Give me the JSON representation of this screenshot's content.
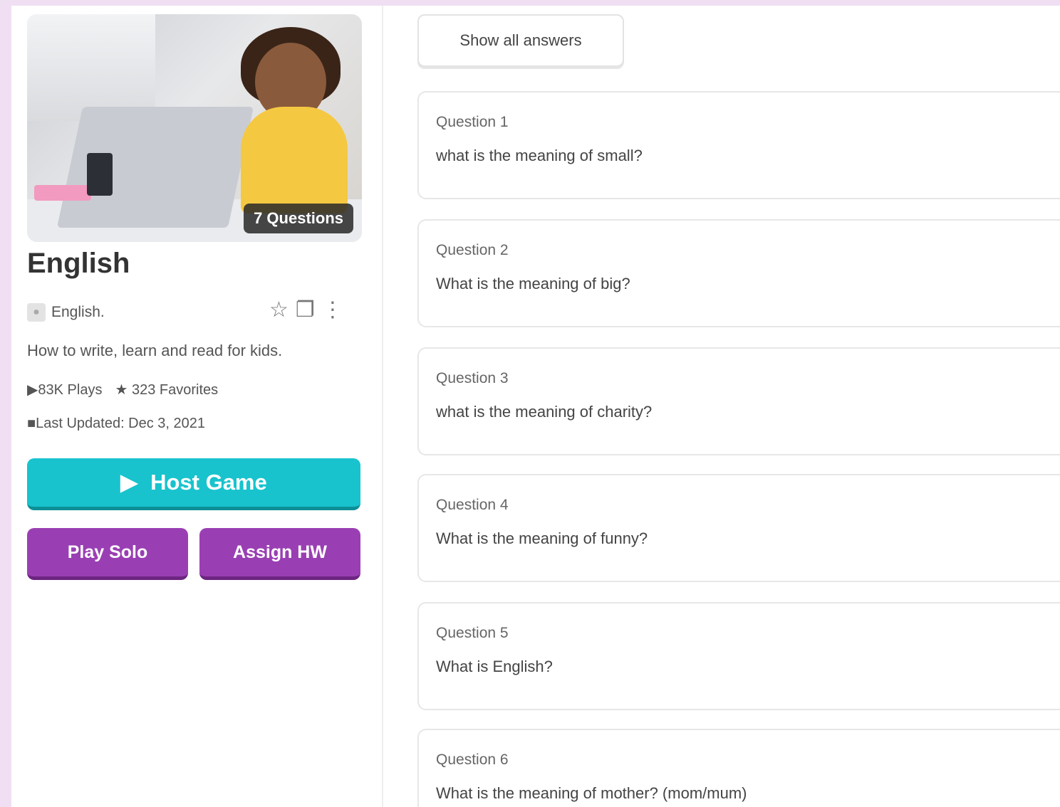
{
  "quiz": {
    "question_count_badge": "7 Questions",
    "title": "English",
    "author": "English.",
    "description": "How to write, learn and read for kids.",
    "plays": "83K Plays",
    "favorites": "323 Favorites",
    "last_updated": "Last Updated: Dec 3, 2021"
  },
  "buttons": {
    "host_game": "Host Game",
    "play_solo": "Play Solo",
    "assign_hw": "Assign HW",
    "show_all_answers": "Show all answers"
  },
  "icons": {
    "favorite": "star-outline-icon",
    "copy": "copy-icon",
    "more": "more-vertical-icon",
    "play": "play-icon",
    "calendar": "calendar-icon",
    "star": "star-icon"
  },
  "colors": {
    "host": "#18c3cd",
    "secondary": "#9a3fb3",
    "background": "#f0dff3"
  },
  "questions": [
    {
      "label": "Question 1",
      "text": "what is the meaning of small?"
    },
    {
      "label": "Question 2",
      "text": "What is the meaning of big?"
    },
    {
      "label": "Question 3",
      "text": "what is the meaning of charity?"
    },
    {
      "label": "Question 4",
      "text": "What is the meaning of funny?"
    },
    {
      "label": "Question 5",
      "text": "What is English?"
    },
    {
      "label": "Question 6",
      "text": "What is the meaning of mother? (mom/mum)"
    }
  ]
}
